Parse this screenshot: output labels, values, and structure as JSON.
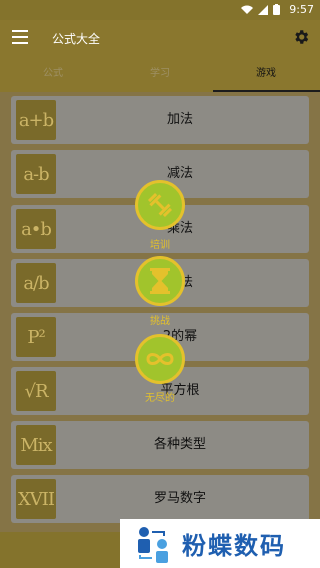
{
  "status_bar": {
    "time": "9:57",
    "icons": [
      "wifi-icon",
      "signal-icon",
      "battery-icon"
    ]
  },
  "app_bar": {
    "title": "公式大全"
  },
  "tabs": [
    {
      "label": "公式",
      "active": false
    },
    {
      "label": "学习",
      "active": false
    },
    {
      "label": "游戏",
      "active": true
    }
  ],
  "cards": [
    {
      "tile": "a+b",
      "label": "加法"
    },
    {
      "tile": "a-b",
      "label": "减法"
    },
    {
      "tile": "a•b",
      "label": "乘法"
    },
    {
      "tile": "a/b",
      "label": "除法"
    },
    {
      "tile": "P²",
      "label": "2的幂"
    },
    {
      "tile": "√R",
      "label": "平方根"
    },
    {
      "tile": "Mix",
      "label": "各种类型"
    },
    {
      "tile": "XVII",
      "label": "罗马数字"
    }
  ],
  "fab_menu": [
    {
      "label": "培训",
      "icon": "dumbbell-icon"
    },
    {
      "label": "挑战",
      "icon": "hourglass-icon"
    },
    {
      "label": "无尽的",
      "icon": "infinity-icon"
    }
  ],
  "watermark": {
    "text": "粉蝶数码"
  },
  "colors": {
    "accent": "#e4c12c",
    "fab": "#a1c42c",
    "appbar": "#8a772e"
  }
}
